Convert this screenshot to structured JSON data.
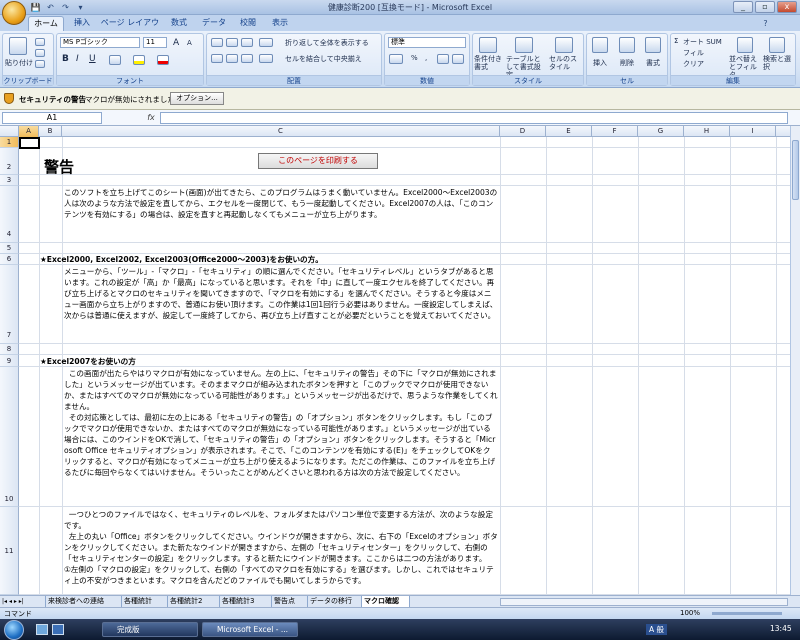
{
  "window": {
    "title": "健康診断200  [互換モード] - Microsoft Excel",
    "min": "_",
    "max": "▫",
    "close": "x"
  },
  "qat": [
    "💾",
    "↶",
    "↷",
    "▾"
  ],
  "tabs": [
    "ホーム",
    "挿入",
    "ページ レイアウト",
    "数式",
    "データ",
    "校閲",
    "表示"
  ],
  "ribbon": {
    "clipboard": {
      "label": "クリップボード",
      "paste": "貼り付け"
    },
    "font": {
      "label": "フォント",
      "name": "MS Pゴシック",
      "size": "11",
      "bold": "B",
      "italic": "I",
      "underline": "U",
      "grow": "A",
      "shrink": "A"
    },
    "alignment": {
      "label": "配置",
      "wrap": "折り返して全体を表示する",
      "merge": "セルを結合して中央揃え"
    },
    "number": {
      "label": "数値",
      "format": "標準",
      "percent": "%",
      "comma": ","
    },
    "styles": {
      "label": "スタイル",
      "conditional": "条件付き書式",
      "table": "テーブルとして書式設定",
      "cell": "セルのスタイル"
    },
    "cells": {
      "label": "セル",
      "insert": "挿入",
      "delete": "削除",
      "format": "書式"
    },
    "editing": {
      "label": "編集",
      "autosum": "オート SUM",
      "fill": "フィル",
      "clear": "クリア",
      "sort": "並べ替えとフィルタ",
      "find": "検索と選択"
    }
  },
  "security": {
    "label": "セキュリティの警告",
    "message": "マクロが無効にされました。",
    "options": "オプション..."
  },
  "formula": {
    "namebox": "A1",
    "fx": "fx",
    "value": ""
  },
  "columns": [
    "A",
    "B",
    "C",
    "D",
    "E",
    "F",
    "G",
    "H",
    "I"
  ],
  "rows": [
    "1",
    "2",
    "3",
    "4",
    "5",
    "6",
    "7",
    "8",
    "9",
    "10",
    "11"
  ],
  "content": {
    "warning": "警告",
    "print_button": "このページを印刷する",
    "para1": "このソフトを立ち上げてこのシート(画面)が出てきたら、このプログラムはうまく動いていません。Excel2000～Excel2003の人は次のような方法で設定を直してから、エクセルを一度閉じて、もう一度起動してください。Excel2007の人は、「このコンテンツを有効にする」の場合は、設定を直すと再起動しなくてもメニューが立ち上がります。",
    "heading1": "★Excel2000, Excel2002, Excel2003(Office2000～2003)をお使いの方。",
    "para2": "メニューから、「ツール」-「マクロ」-「セキュリティ」の順に選んでください。「セキュリティレベル」というタブがあると思います。これの設定が「高」か「最高」になっていると思います。それを「中」に直して一度エクセルを終了してください。再び立ち上げるとマクロのセキュリティを聞いてきますので、「マクロを有効にする」を選んでください。そうすると今度はメニュー画面から立ち上がりますので、普通にお使い頂けます。この作業は1回1回行う必要はありません。一度設定してしまえば、次からは普通に使えますが、設定して一度終了してから、再び立ち上げ直すことが必要だということを覚えておいてください。",
    "heading2": "★Excel2007をお使いの方",
    "para3": "  この画面が出たらやはりマクロが有効になっていません。左の上に、「セキュリティの警告」その下に「マクロが無効にされました」というメッセージが出ています。そのままマクロが組み込まれたボタンを押すと「このブックでマクロが使用できないか、またはすべてのマクロが無効になっている可能性があります。」というメッセージが出るだけで、思うような作業をしてくれません。\n  その対応策としては、最初に左の上にある「セキュリティの警告」の「オプション」ボタンをクリックします。もし「このブックでマクロが使用できないか、またはすべてのマクロが無効になっている可能性があります。」というメッセージが出ている場合には、このウインドをOKで消して、「セキュリティの警告」の「オプション」ボタンをクリックします。そうすると「Microsoft Office セキュリティオプション」が表示されます。そこで、「このコンテンツを有効にする(E)」をチェックしてOKをクリックすると、マクロが有効になってメニューが立ち上がり使えるようになります。ただこの作業は、このファイルを立ち上げるたびに毎回やらなくてはいけません。そういったことがめんどくさいと思われる方は次の方法で設定してください。",
    "para4": "  一つひとつのファイルではなく、セキュリティのレベルを、フォルダまたはパソコン単位で変更する方法が、次のような設定です。\n  左上の丸い「Office」ボタンをクリックしてください。ウインドウが開きますから、次に、右下の「Excelのオプション」ボタンをクリックしてください。また新たなウインドが開きますから、左側の「セキュリティセンター」をクリックして、右側の「セキュリティセンターの設定」をクリックします。すると新たにウインドが開きます。ここからは二つの方法があります。\n①左側の「マクロの設定」をクリックして、右側の「すべてのマクロを有効にする」を選びます。しかし、これではセキュリティ上の不安がつきまといます。マクロを含んだどのファイルでも開いてしまうからです。"
  },
  "sheets": [
    "来検診者への連絡",
    "各種統計",
    "各種統計2",
    "各種統計3",
    "警告点",
    "データの移行",
    "マクロ確認"
  ],
  "status": {
    "mode": "コマンド",
    "zoom": "100%"
  },
  "taskbar": {
    "items": [
      "完成版",
      "Microsoft Excel - ..."
    ],
    "lang": "A 般",
    "time": "13:45"
  }
}
